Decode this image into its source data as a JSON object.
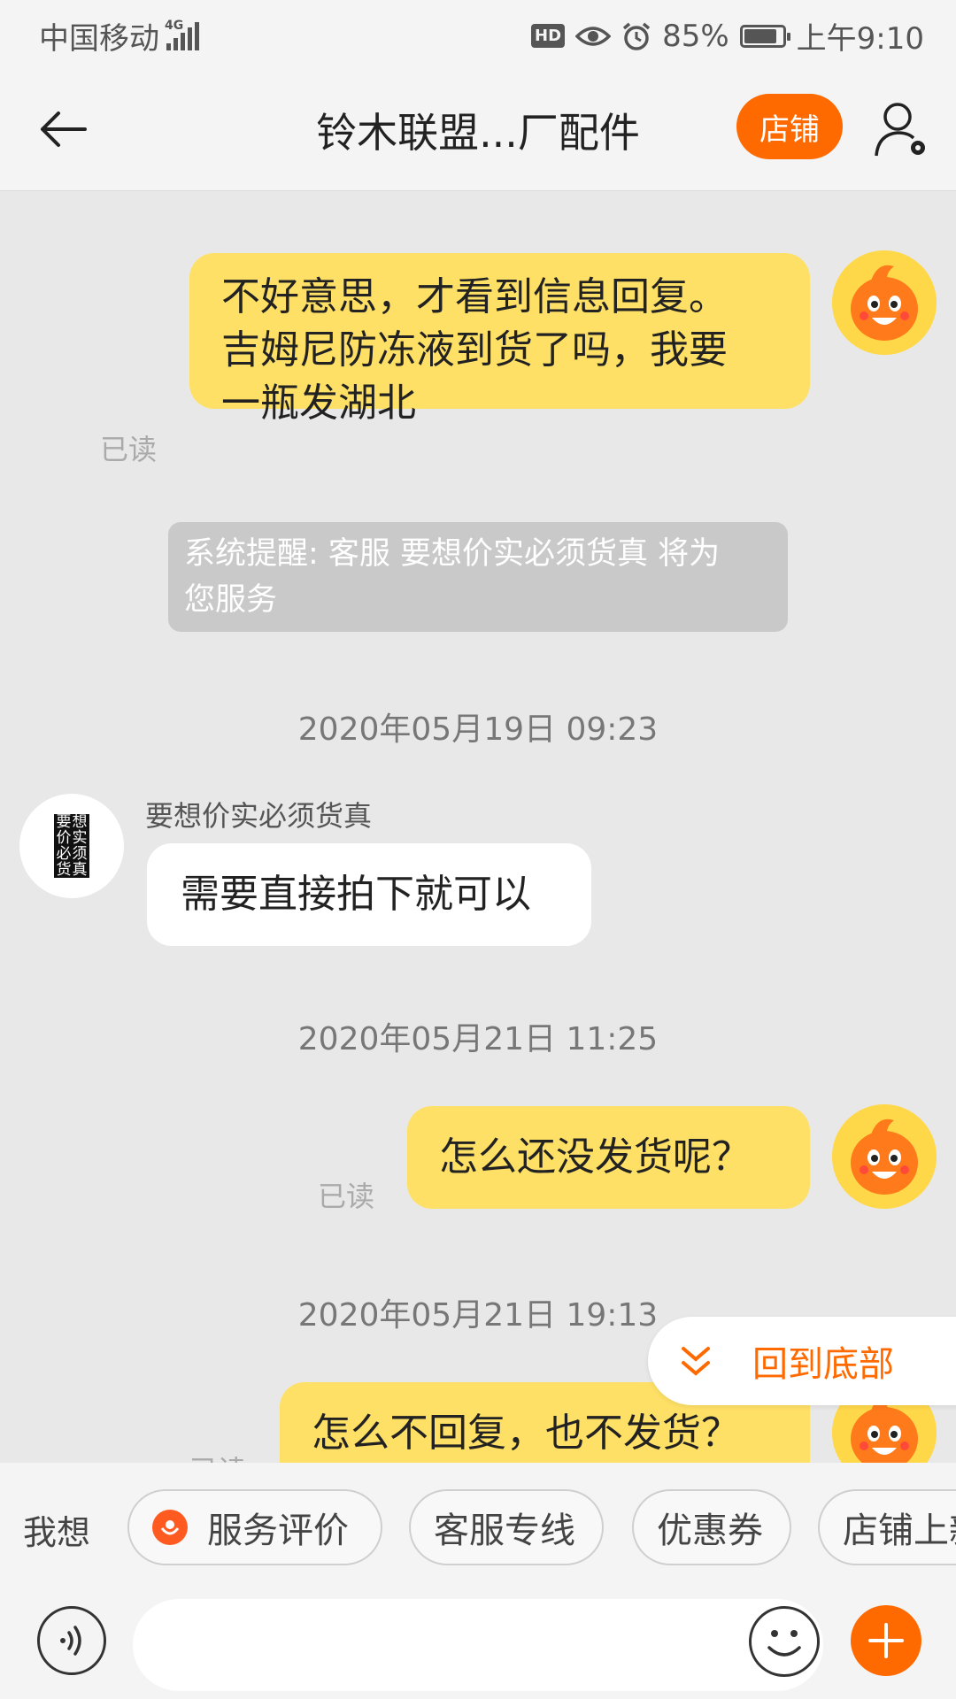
{
  "status_bar": {
    "carrier": "中国移动",
    "network": "4G",
    "hd_badge": "HD",
    "battery": "85%",
    "time": "上午9:10"
  },
  "header": {
    "title": "铃木联盟...厂配件",
    "shop_button": "店铺"
  },
  "messages": {
    "m1": {
      "lines": [
        "不好意思，才看到信息回复。",
        "吉姆尼防冻液到货了吗，我要",
        "一瓶发湖北"
      ],
      "read": "已读"
    },
    "system": {
      "lines": [
        "系统提醒: 客服 要想价实必须货真 将为",
        "您服务"
      ]
    },
    "ts1": "2020年05月19日 09:23",
    "seller": {
      "name": "要想价实必须货真",
      "avatar_text": [
        "要",
        "想",
        "价",
        "实",
        "必",
        "须",
        "货",
        "真"
      ],
      "text": "需要直接拍下就可以"
    },
    "ts2": "2020年05月21日 11:25",
    "m2": {
      "text": "怎么还没发货呢？",
      "read": "已读"
    },
    "ts3": "2020年05月21日 19:13",
    "m3": {
      "text": "怎么不回复，也不发货？",
      "read": "已读"
    }
  },
  "scroll_to_bottom": "回到底部",
  "shortcuts": {
    "prefix": "我想",
    "items": [
      "服务评价",
      "客服专线",
      "优惠券",
      "店铺上新"
    ]
  },
  "input": {
    "placeholder": ""
  },
  "colors": {
    "accent": "#ff6a00",
    "my_bubble": "#ffe066",
    "chat_background": "#e8e8e8"
  }
}
